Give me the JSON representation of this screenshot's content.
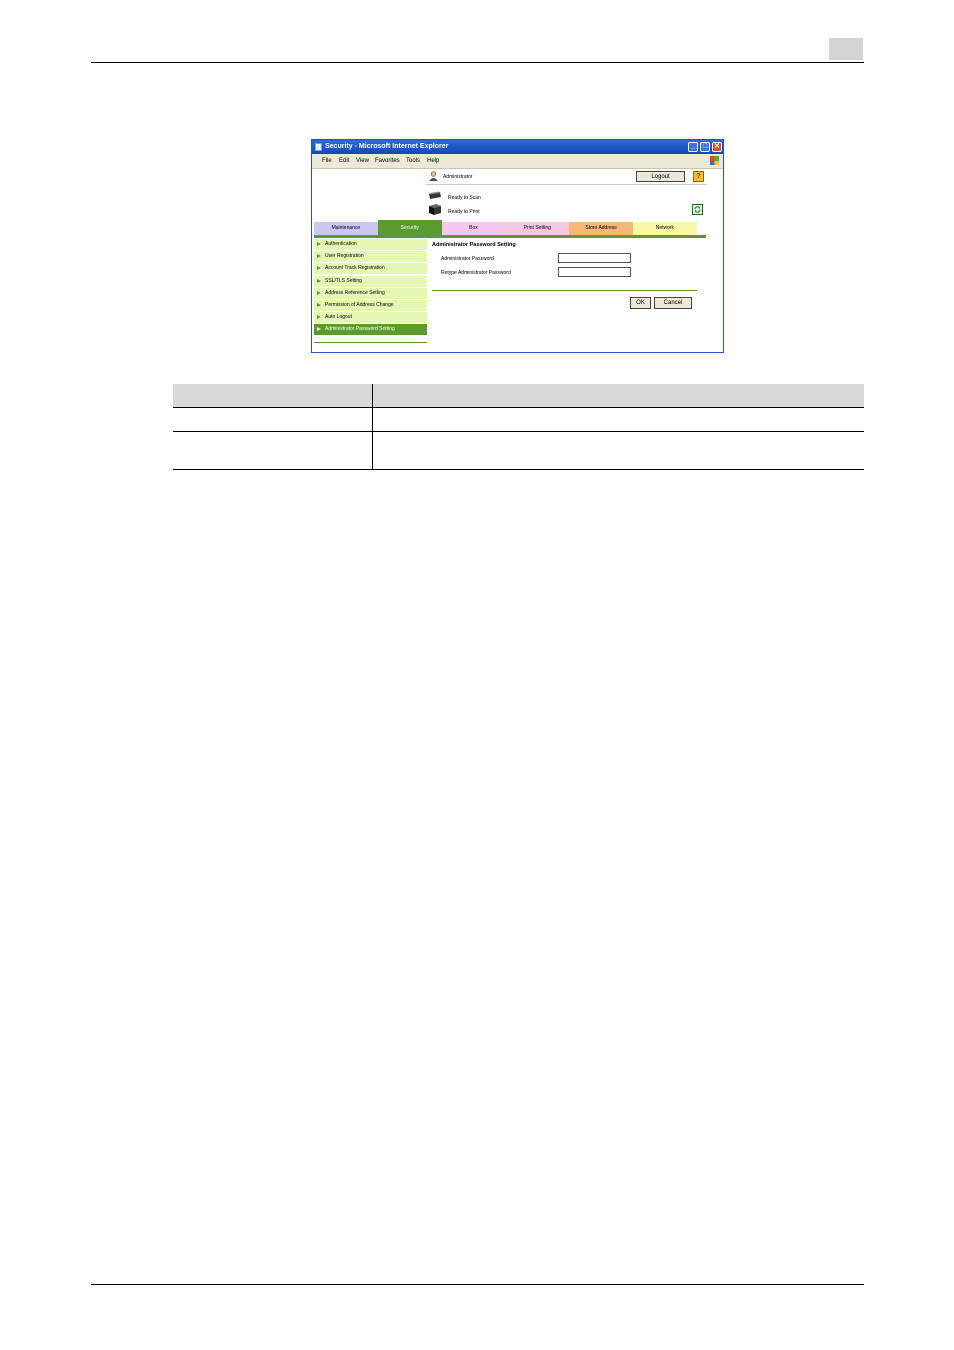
{
  "window": {
    "title": "Security - Microsoft Internet Explorer",
    "menu": [
      "File",
      "Edit",
      "View",
      "Favorites",
      "Tools",
      "Help"
    ],
    "controls": {
      "minimize": "_",
      "maximize": "□",
      "close": "✕"
    }
  },
  "header": {
    "user_label": "Administrator",
    "logout_label": "Logout",
    "help_label": "?",
    "status_scan": "Ready to Scan",
    "status_print": "Ready to Print"
  },
  "tabs": [
    {
      "label": "Maintenance",
      "color": "#c8c8f0"
    },
    {
      "label": "Security",
      "color": "#5b9a2e"
    },
    {
      "label": "Box",
      "color": "#f5c8f0"
    },
    {
      "label": "Print Setting",
      "color": "#f8c8e0"
    },
    {
      "label": "Store Address",
      "color": "#f5b878"
    },
    {
      "label": "Network",
      "color": "#f8f8a8"
    }
  ],
  "sidebar": {
    "items": [
      {
        "label": "Authentication"
      },
      {
        "label": "User Registration"
      },
      {
        "label": "Account Track Registration"
      },
      {
        "label": "SSL/TLS Setting"
      },
      {
        "label": "Address Reference Setting"
      },
      {
        "label": "Permission of Address Change"
      },
      {
        "label": "Auto Logout"
      },
      {
        "label": "Administrator Password Setting"
      }
    ]
  },
  "main": {
    "heading": "Administrator Password Setting",
    "field1_label": "Administrator Password",
    "field1_value": "",
    "field2_label": "Retype Administrator Password",
    "field2_value": "",
    "ok_label": "OK",
    "cancel_label": "Cancel"
  },
  "colors": {
    "accent_green": "#5b9a2e",
    "sidebar_bg": "#e4f8b4"
  }
}
